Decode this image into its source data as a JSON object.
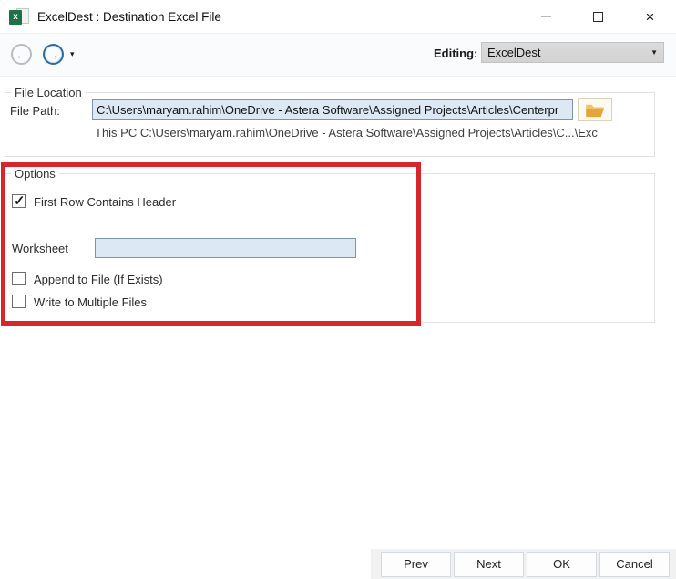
{
  "window": {
    "title": "ExcelDest : Destination Excel File",
    "excel_icon_glyph": "x",
    "close_glyph": "×"
  },
  "toolbar": {
    "back_glyph": "←",
    "forward_glyph": "→",
    "caret_glyph": "▾",
    "editing_label": "Editing:",
    "editing_value": "ExcelDest",
    "combo_arrow_glyph": "▼"
  },
  "file_location": {
    "group_label": "File Location",
    "file_path_label": "File Path:",
    "file_path_value": "C:\\Users\\maryam.rahim\\OneDrive - Astera Software\\Assigned Projects\\Articles\\Centerpr",
    "resolved_path": "This PC C:\\Users\\maryam.rahim\\OneDrive - Astera Software\\Assigned Projects\\Articles\\C...\\Exc"
  },
  "options": {
    "group_label": "Options",
    "first_row_header": {
      "label": "First Row Contains Header",
      "checked": true
    },
    "worksheet": {
      "label": "Worksheet",
      "value": ""
    },
    "append_to_file": {
      "label": "Append to File (If Exists)",
      "checked": false
    },
    "write_multiple": {
      "label": "Write to Multiple Files",
      "checked": false
    }
  },
  "footer": {
    "buttons": [
      "Prev",
      "Next",
      "OK",
      "Cancel"
    ]
  },
  "colors": {
    "excel_green": "#1e7145",
    "annotation_red": "#d6252b",
    "forward_blue": "#2d6ca2",
    "input_bg": "#dce8f4"
  }
}
